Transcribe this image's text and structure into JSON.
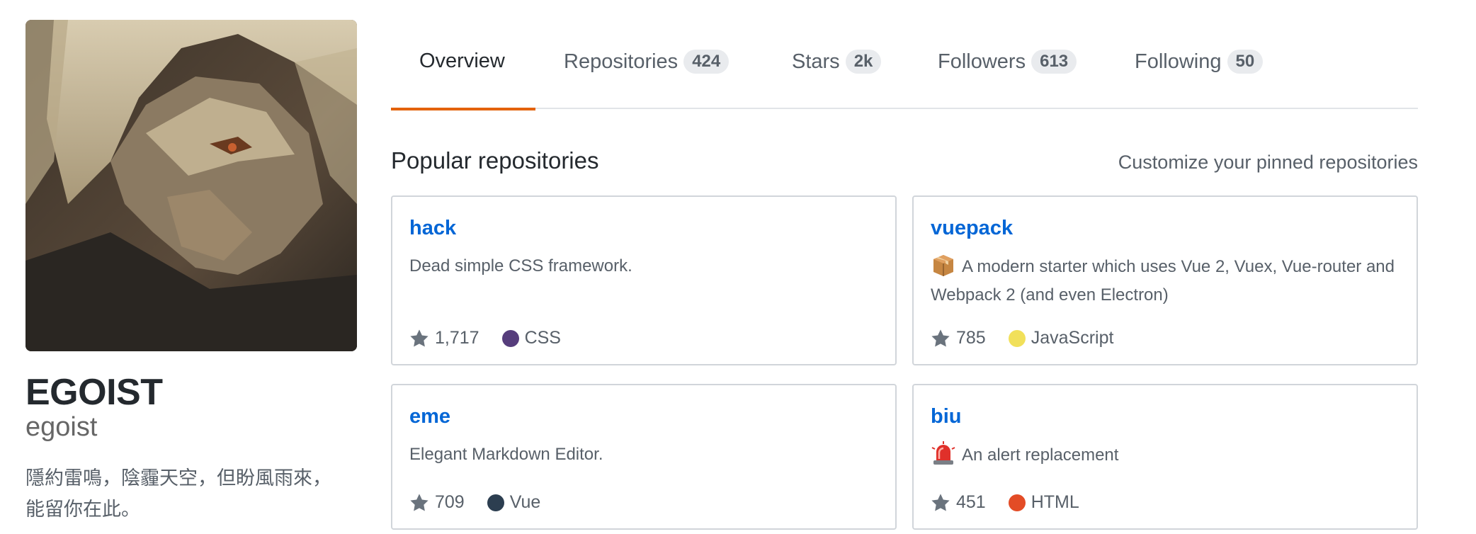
{
  "profile": {
    "fullname": "EGOIST",
    "username": "egoist",
    "bio_lines": [
      "隱約雷鳴，陰霾天空，但盼風雨來，",
      "能留你在此。"
    ]
  },
  "tabs": [
    {
      "label": "Overview",
      "count": null,
      "selected": true
    },
    {
      "label": "Repositories",
      "count": "424",
      "selected": false
    },
    {
      "label": "Stars",
      "count": "2k",
      "selected": false
    },
    {
      "label": "Followers",
      "count": "613",
      "selected": false
    },
    {
      "label": "Following",
      "count": "50",
      "selected": false
    }
  ],
  "popular": {
    "title": "Popular repositories",
    "customize_label": "Customize your pinned repositories"
  },
  "repos": [
    {
      "name": "hack",
      "emoji": null,
      "description": "Dead simple CSS framework.",
      "stars": "1,717",
      "language": "CSS",
      "language_color": "#563d7c"
    },
    {
      "name": "vuepack",
      "emoji": "package-emoji",
      "description": "A modern starter which uses Vue 2, Vuex, Vue-router and Webpack 2 (and even Electron)",
      "stars": "785",
      "language": "JavaScript",
      "language_color": "#f1e05a"
    },
    {
      "name": "eme",
      "emoji": null,
      "description": "Elegant Markdown Editor.",
      "stars": "709",
      "language": "Vue",
      "language_color": "#2c3e50"
    },
    {
      "name": "biu",
      "emoji": "rotating-light-emoji",
      "description": "An alert replacement",
      "stars": "451",
      "language": "HTML",
      "language_color": "#e34c26"
    }
  ],
  "colors": {
    "accent_tab": "#e36209",
    "link": "#0366d6"
  }
}
